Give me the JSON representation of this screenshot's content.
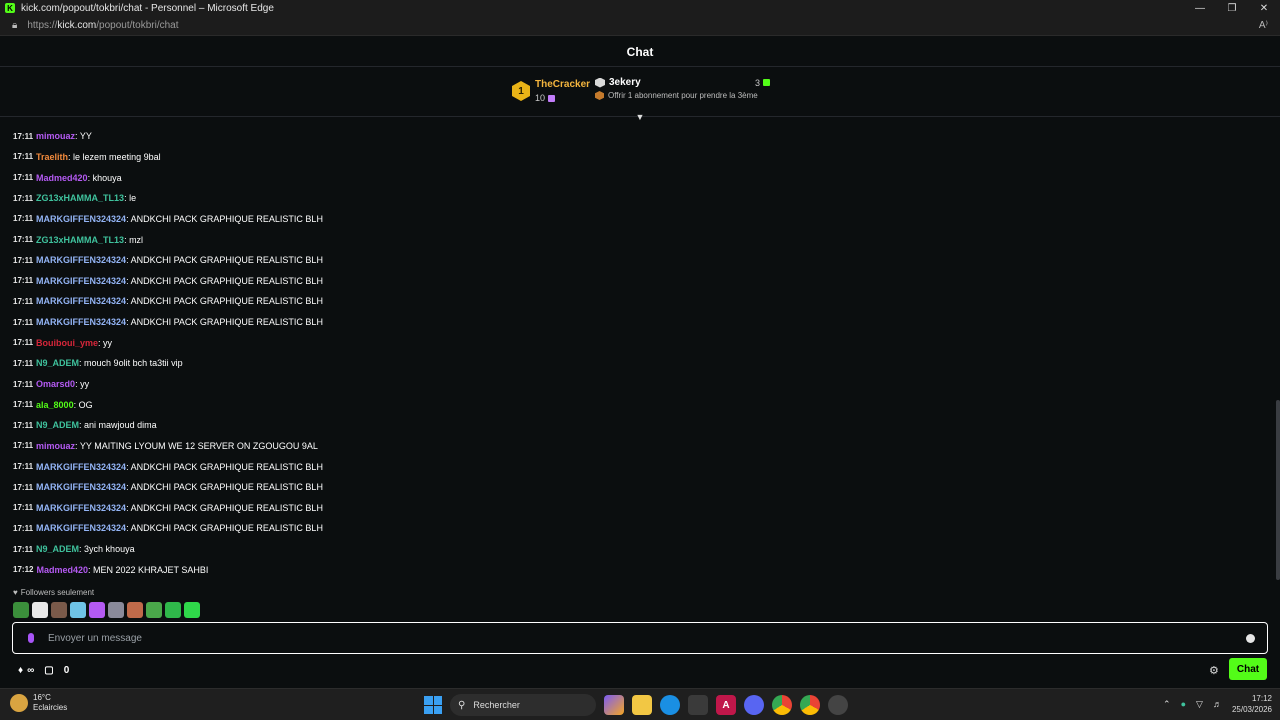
{
  "window": {
    "title": "kick.com/popout/tokbri/chat - Personnel – Microsoft Edge",
    "url_prefix": "https://",
    "url_host": "kick.com",
    "url_path": "/popout/tokbri/chat",
    "read_aloud_label": "A⁾"
  },
  "chat": {
    "header": "Chat",
    "leaderboard": {
      "rank": "1",
      "top_user": "TheCracker",
      "top_count": "10",
      "sub_user": "3ekery",
      "sub_count": "3",
      "sub_prompt": "Offrir 1 abonnement pour prendre la 3ème"
    },
    "messages": [
      {
        "time": "17:11",
        "user": "mimouaz",
        "color": "#b45af2",
        "text": ": YY"
      },
      {
        "time": "17:11",
        "user": "Traelith",
        "color": "#f28a3c",
        "text": ": le lezem meeting 9bal"
      },
      {
        "time": "17:11",
        "user": "Madmed420",
        "color": "#b45af2",
        "text": ": khouya"
      },
      {
        "time": "17:11",
        "user": "ZG13xHAMMA_TL13",
        "color": "#3fc29d",
        "text": ": le"
      },
      {
        "time": "17:11",
        "user": "MARKGIFFEN324324",
        "color": "#93b4f5",
        "text": ": ANDKCHI PACK GRAPHIQUE REALISTIC BLH"
      },
      {
        "time": "17:11",
        "user": "ZG13xHAMMA_TL13",
        "color": "#3fc29d",
        "text": ": mzl"
      },
      {
        "time": "17:11",
        "user": "MARKGIFFEN324324",
        "color": "#93b4f5",
        "text": ": ANDKCHI PACK GRAPHIQUE REALISTIC BLH"
      },
      {
        "time": "17:11",
        "user": "MARKGIFFEN324324",
        "color": "#93b4f5",
        "text": ": ANDKCHI PACK GRAPHIQUE REALISTIC BLH"
      },
      {
        "time": "17:11",
        "user": "MARKGIFFEN324324",
        "color": "#93b4f5",
        "text": ": ANDKCHI PACK GRAPHIQUE REALISTIC BLH"
      },
      {
        "time": "17:11",
        "user": "MARKGIFFEN324324",
        "color": "#93b4f5",
        "text": ": ANDKCHI PACK GRAPHIQUE REALISTIC BLH"
      },
      {
        "time": "17:11",
        "user": "Bouiboui_yme",
        "color": "#d6263a",
        "text": ": yy"
      },
      {
        "time": "17:11",
        "user": "N9_ADEM",
        "color": "#3fc29d",
        "text": ": mouch 9olit bch ta3tii vip"
      },
      {
        "time": "17:11",
        "user": "Omarsd0",
        "color": "#b45af2",
        "text": ": yy"
      },
      {
        "time": "17:11",
        "user": "ala_8000",
        "color": "#53fc18",
        "text": ": OG"
      },
      {
        "time": "17:11",
        "user": "N9_ADEM",
        "color": "#3fc29d",
        "text": ": ani mawjoud dima"
      },
      {
        "time": "17:11",
        "user": "mimouaz",
        "color": "#b45af2",
        "text": ": YY MAITING LYOUM WE 12 SERVER ON ZGOUGOU 9AL"
      },
      {
        "time": "17:11",
        "user": "MARKGIFFEN324324",
        "color": "#93b4f5",
        "text": ": ANDKCHI PACK GRAPHIQUE REALISTIC BLH"
      },
      {
        "time": "17:11",
        "user": "MARKGIFFEN324324",
        "color": "#93b4f5",
        "text": ": ANDKCHI PACK GRAPHIQUE REALISTIC BLH"
      },
      {
        "time": "17:11",
        "user": "MARKGIFFEN324324",
        "color": "#93b4f5",
        "text": ": ANDKCHI PACK GRAPHIQUE REALISTIC BLH"
      },
      {
        "time": "17:11",
        "user": "MARKGIFFEN324324",
        "color": "#93b4f5",
        "text": ": ANDKCHI PACK GRAPHIQUE REALISTIC BLH"
      },
      {
        "time": "17:11",
        "user": "N9_ADEM",
        "color": "#3fc29d",
        "text": ": 3ych khouya"
      },
      {
        "time": "17:12",
        "user": "Madmed420",
        "color": "#b45af2",
        "text": ": MEN 2022 KHRAJET SAHBI"
      }
    ],
    "followers_label": "Followers seulement",
    "emotes": [
      "#3b8f3b",
      "#e8e8e8",
      "#7a5a4a",
      "#6fc3e6",
      "#b45af2",
      "#8a8a9a",
      "#c06a4a",
      "#4aa84a",
      "#2fb84a",
      "#2fd84a"
    ],
    "input_placeholder": "Envoyer un message",
    "infinity_label": "∞",
    "points": "0",
    "chat_button": "Chat"
  },
  "taskbar": {
    "temperature": "16°C",
    "weather": "Eclaircies",
    "search_label": "Rechercher",
    "time": "17:12",
    "date": "25/03/2026"
  },
  "colors": {
    "accent": "#53fc18",
    "background": "#0b0e0f"
  }
}
